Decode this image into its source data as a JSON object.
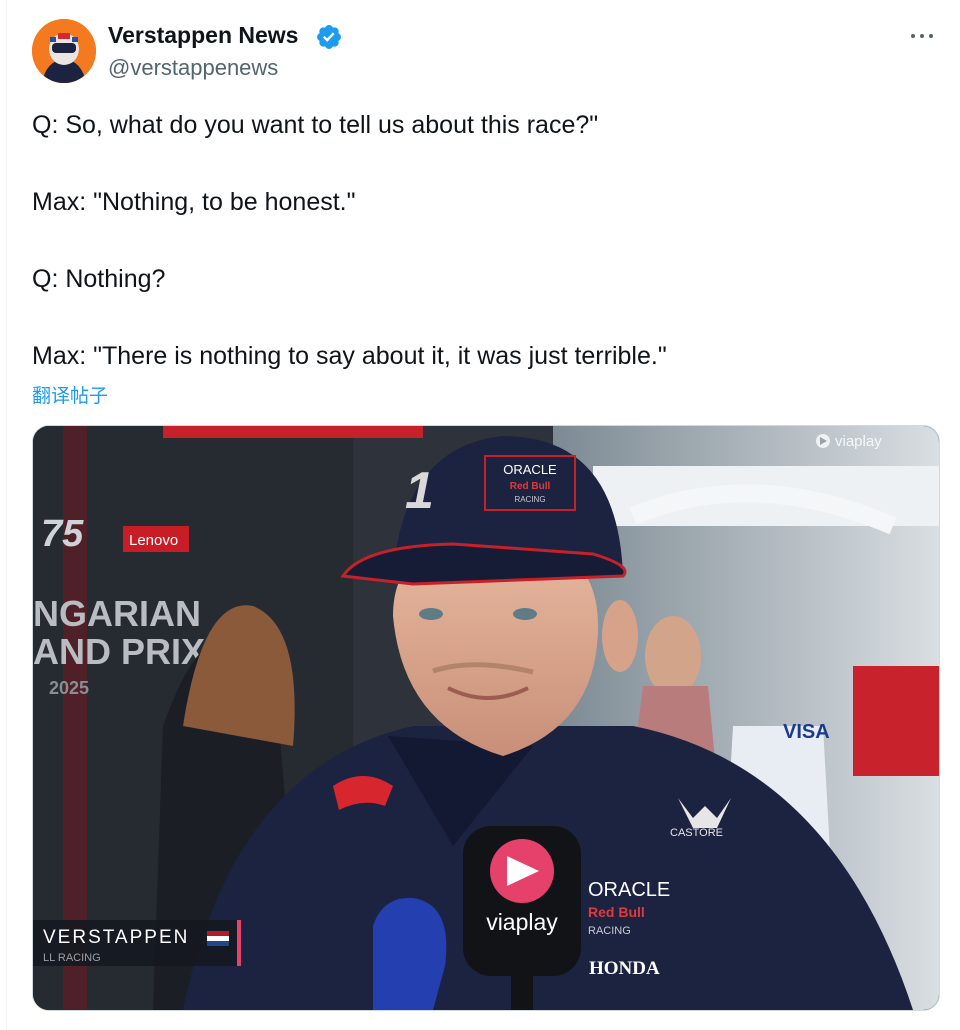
{
  "author": {
    "display_name": "Verstappen News",
    "handle": "@verstappenews",
    "verified": true,
    "badge_color": "#1d9bf0"
  },
  "tweet": {
    "lines": [
      "Q: So, what do you want to tell us about this race?\"",
      "Max: \"Nothing, to be honest.\"",
      "Q: Nothing?",
      "Max: \"There is nothing to say about it, it was just terrible.\""
    ],
    "translate_label": "翻译帖子"
  },
  "media": {
    "watermark": "viaplay",
    "backdrop_text": [
      "NGARIAN",
      "AND PRIX",
      "2025"
    ],
    "sponsor_board": "Lenovo",
    "cap_sponsor": [
      "ORACLE",
      "Red Bull",
      "RACING"
    ],
    "cap_number": "1",
    "mic_label": "viaplay",
    "chest_sponsor": [
      "ORACLE",
      "Red Bull",
      "RACING"
    ],
    "shirt_sponsor": "HONDA",
    "kit_brand": "CASTORE",
    "lower_third_name": "VERSTAPPEN",
    "lower_third_team": "LL RACING",
    "colors": {
      "team_navy": "#1c2340",
      "bull_red": "#d8262e",
      "viaplay_pink": "#e5416b"
    }
  }
}
